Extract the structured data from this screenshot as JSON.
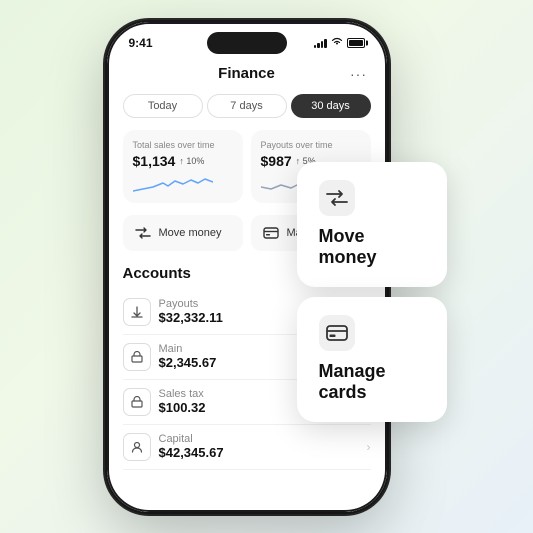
{
  "status": {
    "time": "9:41",
    "signal": [
      3,
      5,
      7,
      9,
      11
    ],
    "wifi": "wifi",
    "battery": "battery"
  },
  "app": {
    "title": "Finance",
    "more_icon": "···"
  },
  "tabs": [
    {
      "label": "Today",
      "active": false
    },
    {
      "label": "7 days",
      "active": false
    },
    {
      "label": "30 days",
      "active": true
    }
  ],
  "stats": [
    {
      "label": "Total sales over time",
      "value": "$1,134",
      "change": "↑ 10%"
    },
    {
      "label": "Payouts over time",
      "value": "$987",
      "change": "↑ 5%"
    }
  ],
  "quick_actions": [
    {
      "icon": "⇄",
      "label": "Move money"
    },
    {
      "icon": "💳",
      "label": "Manage cards"
    }
  ],
  "accounts_title": "Accounts",
  "accounts": [
    {
      "icon": "↓",
      "name": "Payouts",
      "amount": "$32,332.11",
      "has_chevron": false
    },
    {
      "icon": "🏦",
      "name": "Main",
      "amount": "$2,345.67",
      "has_chevron": true
    },
    {
      "icon": "🏦",
      "name": "Sales tax",
      "amount": "$100.32",
      "has_chevron": false
    },
    {
      "icon": "👤",
      "name": "Capital",
      "amount": "$42,345.67",
      "has_chevron": true
    }
  ],
  "floating_cards": [
    {
      "icon": "⇄",
      "label": "Move money"
    },
    {
      "icon": "💳",
      "label": "Manage cards"
    }
  ]
}
